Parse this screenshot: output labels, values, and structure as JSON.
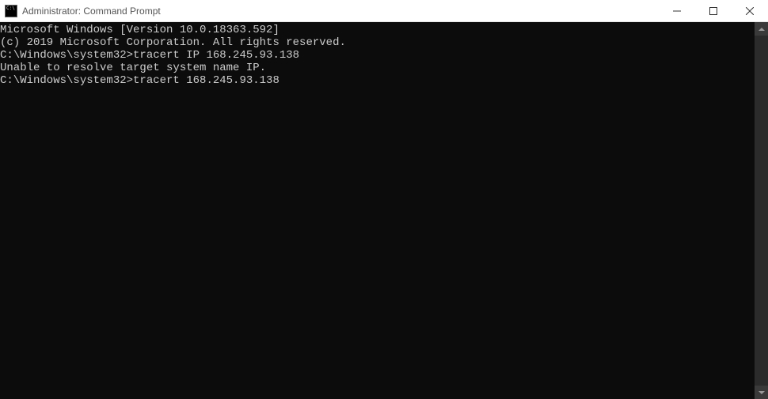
{
  "window": {
    "title": "Administrator: Command Prompt"
  },
  "terminal": {
    "lines": [
      "Microsoft Windows [Version 10.0.18363.592]",
      "(c) 2019 Microsoft Corporation. All rights reserved.",
      "",
      "C:\\Windows\\system32>tracert IP 168.245.93.138",
      "Unable to resolve target system name IP.",
      "",
      "C:\\Windows\\system32>tracert 168.245.93.138"
    ]
  }
}
